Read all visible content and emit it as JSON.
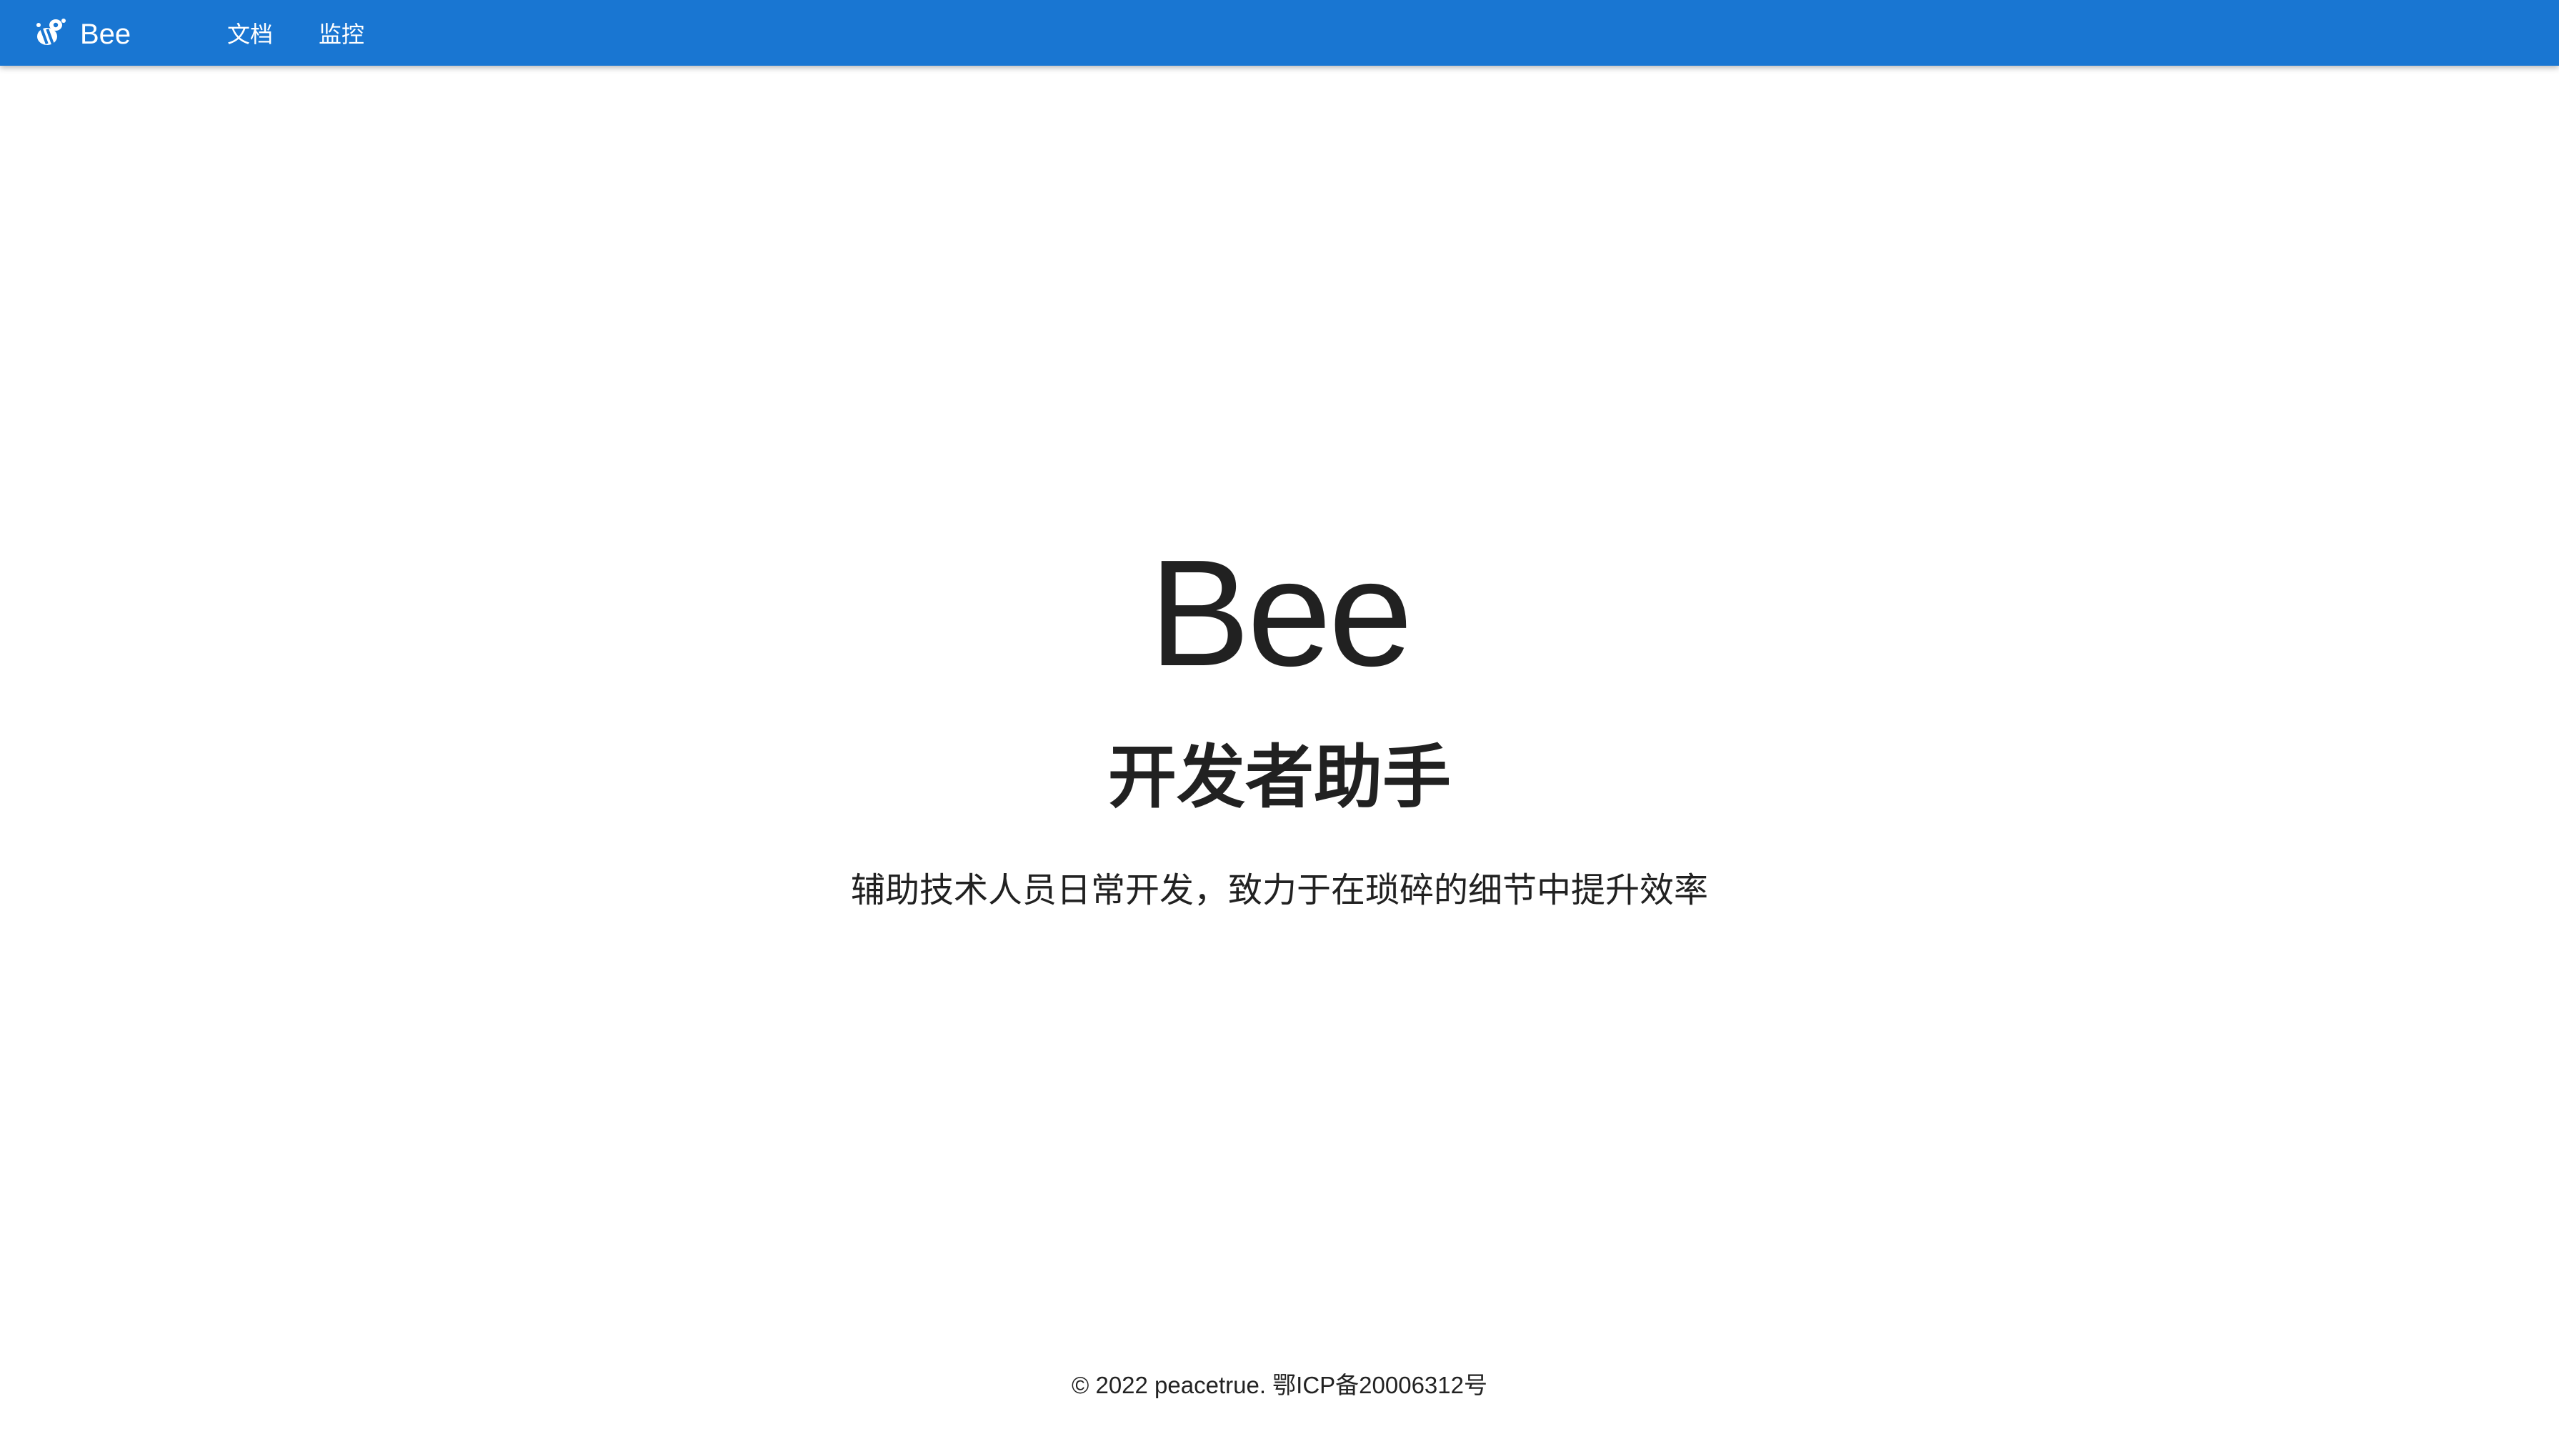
{
  "header": {
    "brand_name": "Bee",
    "logo_icon": "bee-icon",
    "nav": [
      {
        "label": "文档"
      },
      {
        "label": "监控"
      }
    ],
    "bar_color": "#1976d2"
  },
  "hero": {
    "title": "Bee",
    "subtitle": "开发者助手",
    "description": "辅助技术人员日常开发，致力于在琐碎的细节中提升效率"
  },
  "footer": {
    "copyright": "© 2022 peacetrue. 鄂ICP备20006312号"
  }
}
